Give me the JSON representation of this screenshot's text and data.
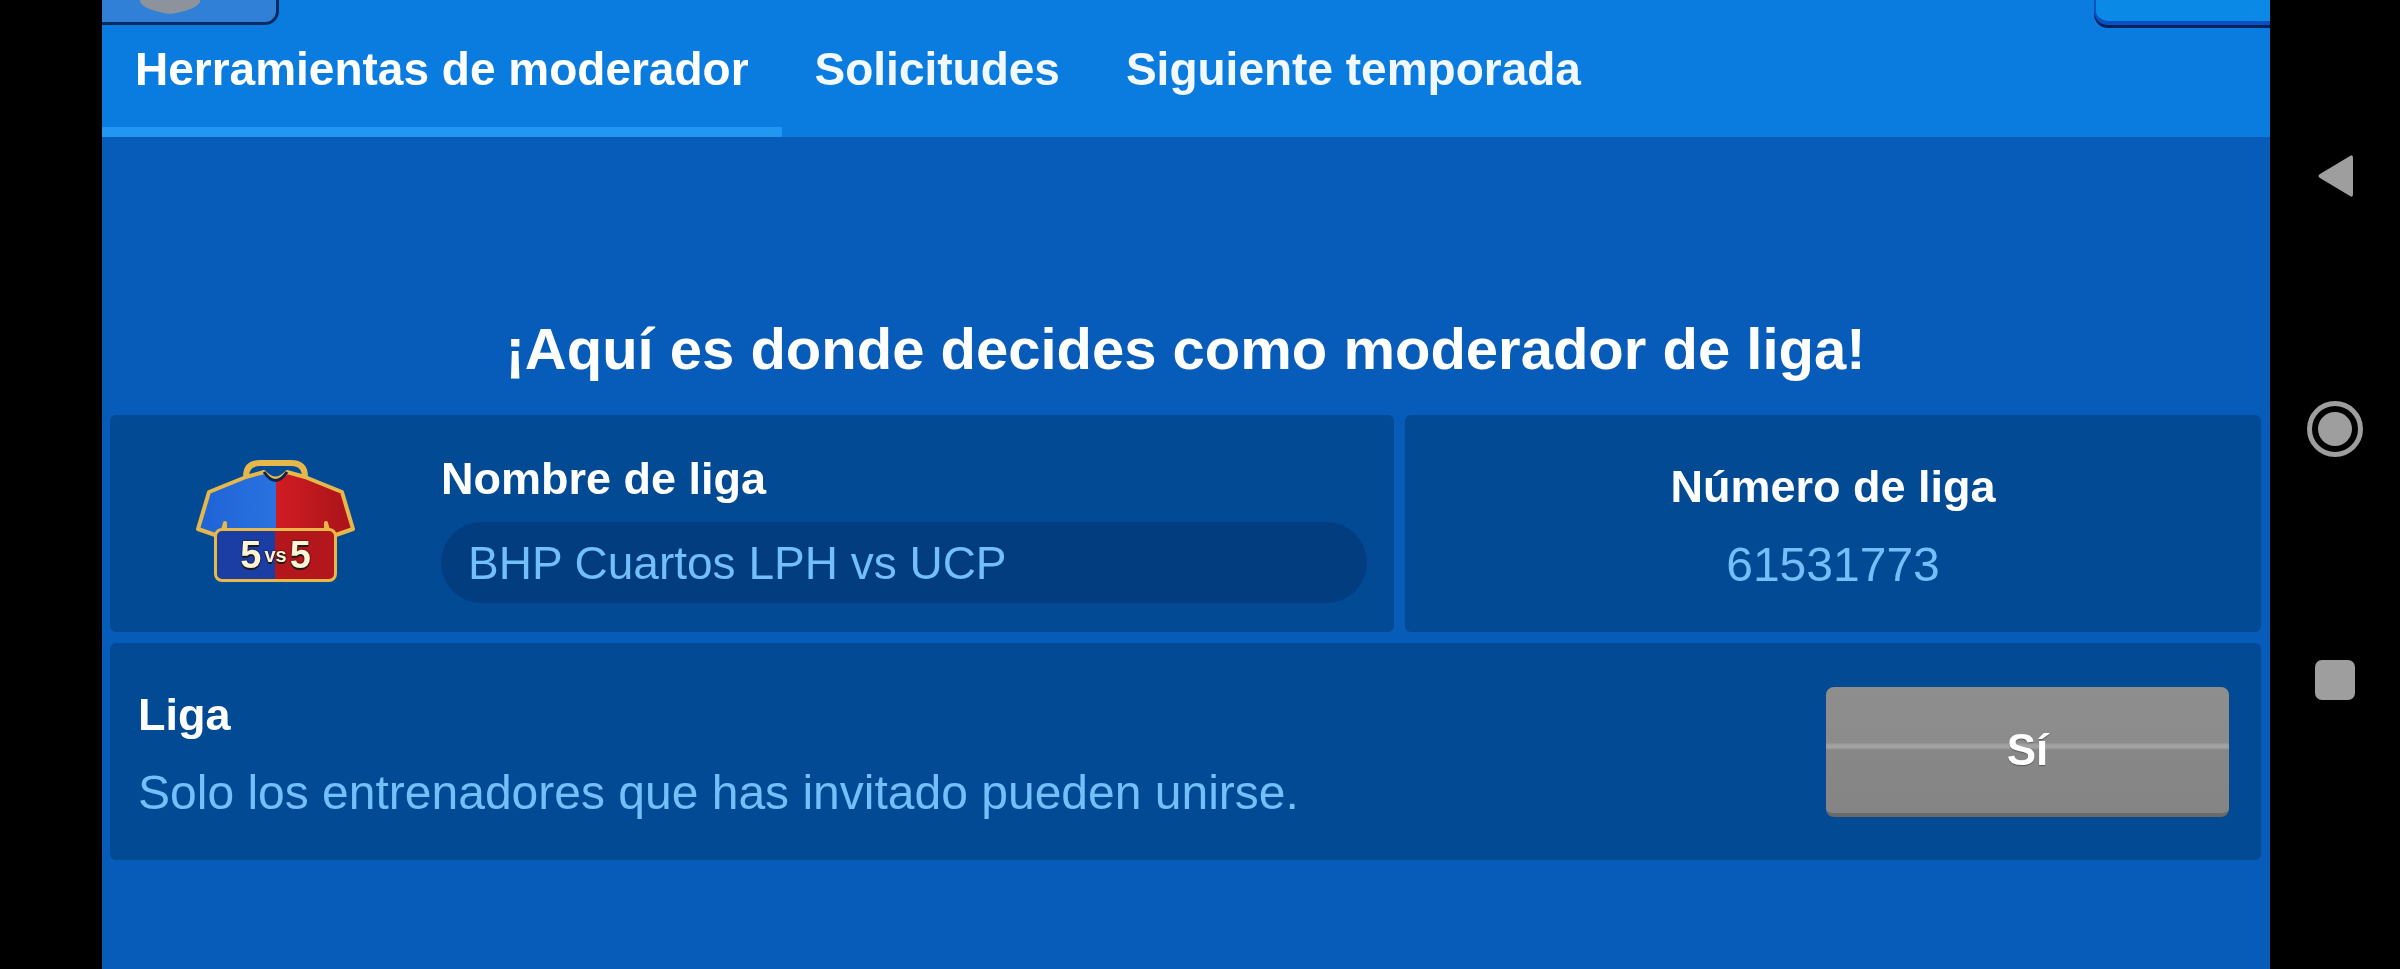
{
  "tabs": [
    {
      "label": "Herramientas de moderador",
      "selected": true
    },
    {
      "label": "Solicitudes",
      "selected": false
    },
    {
      "label": "Siguiente temporada",
      "selected": false
    }
  ],
  "heading": "¡Aquí es donde decides como moderador de liga!",
  "league_name": {
    "label": "Nombre de liga",
    "value": "BHP Cuartos LPH vs UCP",
    "format": [
      "5",
      "vs",
      "5"
    ]
  },
  "league_number": {
    "label": "Número de liga",
    "value": "61531773"
  },
  "privacy": {
    "title": "Liga",
    "description": "Solo los entrenadores que has invitado pueden unirse.",
    "button": "Sí"
  }
}
